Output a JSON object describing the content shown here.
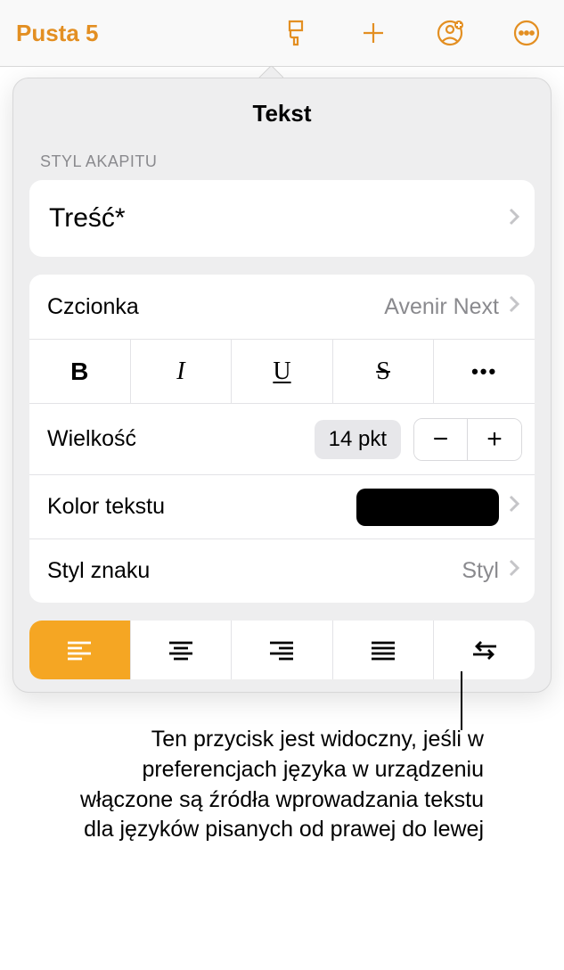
{
  "toolbar": {
    "doc_title": "Pusta 5"
  },
  "panel": {
    "title": "Tekst",
    "section_paragraph_style": "STYL AKAPITU",
    "paragraph_style_value": "Treść*",
    "font": {
      "label": "Czcionka",
      "value": "Avenir Next"
    },
    "style_buttons": {
      "bold": "B",
      "italic": "I",
      "underline": "U",
      "strike": "S",
      "more": "•••"
    },
    "size": {
      "label": "Wielkość",
      "value": "14 pkt",
      "minus": "−",
      "plus": "+"
    },
    "text_color": {
      "label": "Kolor tekstu",
      "value_hex": "#000000"
    },
    "char_style": {
      "label": "Styl znaku",
      "value": "Styl"
    },
    "alignment": {
      "selected": "left"
    }
  },
  "callout": {
    "text": "Ten przycisk jest widoczny, jeśli w preferencjach języka w urządzeniu włączone są źródła wprowadzania tekstu dla języków pisanych od prawej do lewej"
  }
}
